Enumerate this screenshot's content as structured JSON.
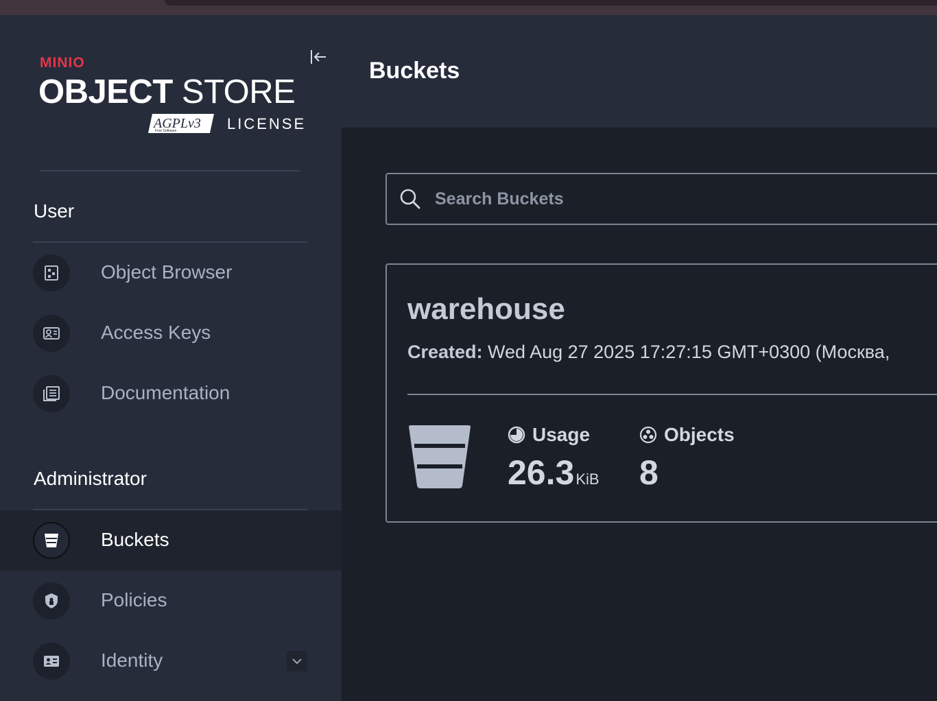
{
  "brand": {
    "minio": "MINIO",
    "object": "OBJECT",
    "store": "STORE",
    "agpl": "AGPLv3",
    "agpl_sub": "Free Software",
    "license": "LICENSE"
  },
  "sidebar": {
    "user_section": "User",
    "user_items": [
      {
        "label": "Object Browser",
        "icon": "object-browser-icon"
      },
      {
        "label": "Access Keys",
        "icon": "access-keys-icon"
      },
      {
        "label": "Documentation",
        "icon": "documentation-icon"
      }
    ],
    "admin_section": "Administrator",
    "admin_items": [
      {
        "label": "Buckets",
        "icon": "bucket-icon",
        "active": true
      },
      {
        "label": "Policies",
        "icon": "policies-icon"
      },
      {
        "label": "Identity",
        "icon": "identity-icon",
        "expandable": true
      }
    ]
  },
  "header": {
    "title": "Buckets"
  },
  "search": {
    "placeholder": "Search Buckets",
    "value": ""
  },
  "bucket": {
    "name": "warehouse",
    "created_label": "Created:",
    "created_value": "Wed Aug 27 2025 17:27:15 GMT+0300 (Москва,",
    "usage_label": "Usage",
    "usage_value": "26.3",
    "usage_unit": "KiB",
    "objects_label": "Objects",
    "objects_value": "8"
  },
  "colors": {
    "accent": "#e2364b",
    "sidebar_bg": "#262c3a",
    "main_bg": "#1b1f27"
  }
}
